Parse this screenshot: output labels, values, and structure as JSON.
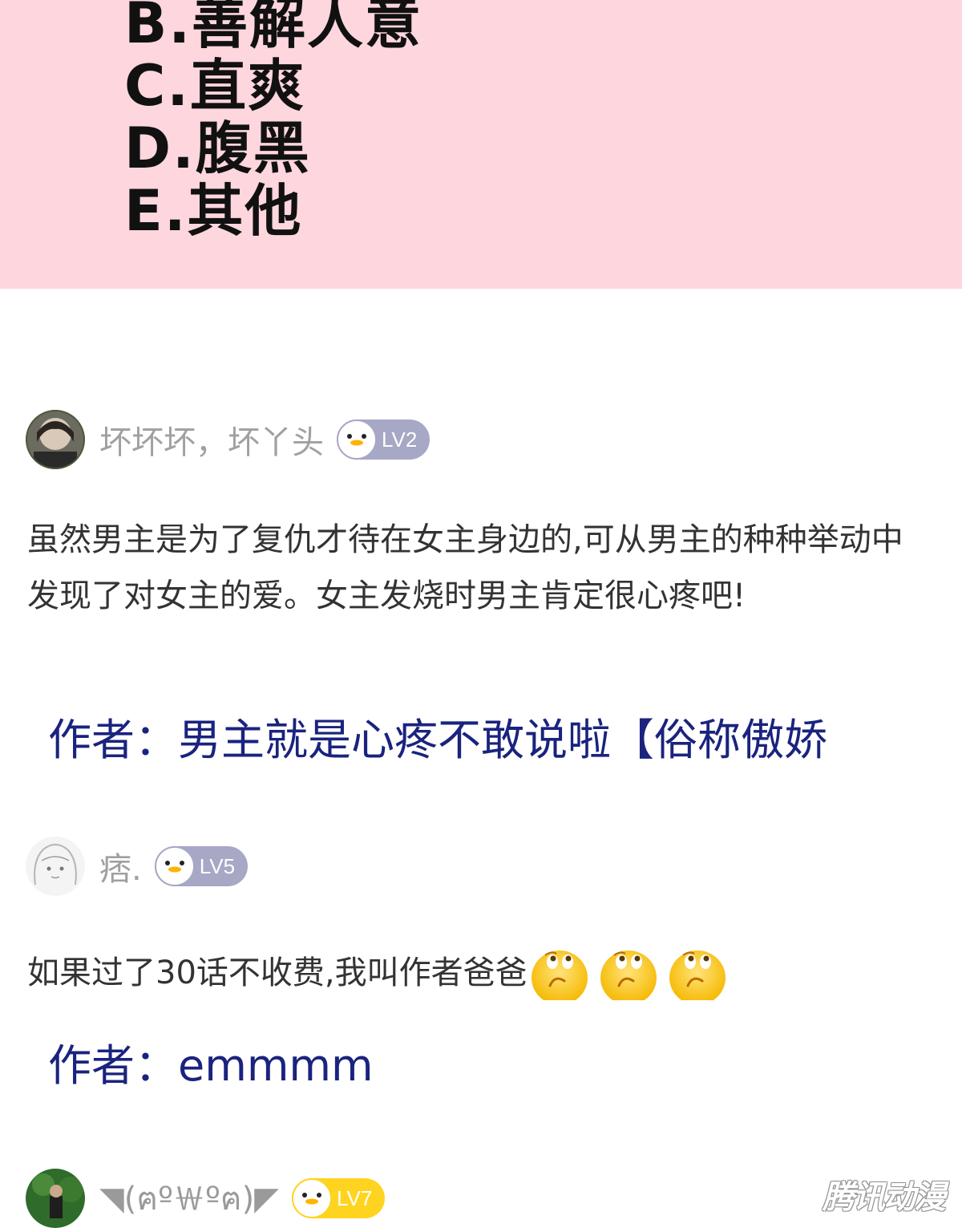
{
  "quiz": {
    "options": [
      "B.善解人意",
      "C.直爽",
      "D.腹黑",
      "E.其他"
    ]
  },
  "comments": [
    {
      "username": "坏坏坏，坏丫头",
      "level": "LV2",
      "badge_color": "#a7a7c6",
      "body": "虽然男主是为了复仇才待在女主身边的,可从男主的种种举动中发现了对女主的爱。女主发烧时男主肯定很心疼吧!",
      "author_reply": "作者：男主就是心疼不敢说啦【俗称傲娇"
    },
    {
      "username": "痞.",
      "level": "LV5",
      "badge_color": "#a7a7c6",
      "body": "如果过了30话不收费,我叫作者爸爸",
      "emoji": [
        "thinking-emoji",
        "thinking-emoji",
        "thinking-emoji"
      ],
      "author_reply": "作者：emmmm"
    },
    {
      "username": "◥(ฅº￦ºฅ)◤",
      "level": "LV7",
      "badge_color": "#ffd420"
    }
  ],
  "watermark": "腾讯动漫"
}
